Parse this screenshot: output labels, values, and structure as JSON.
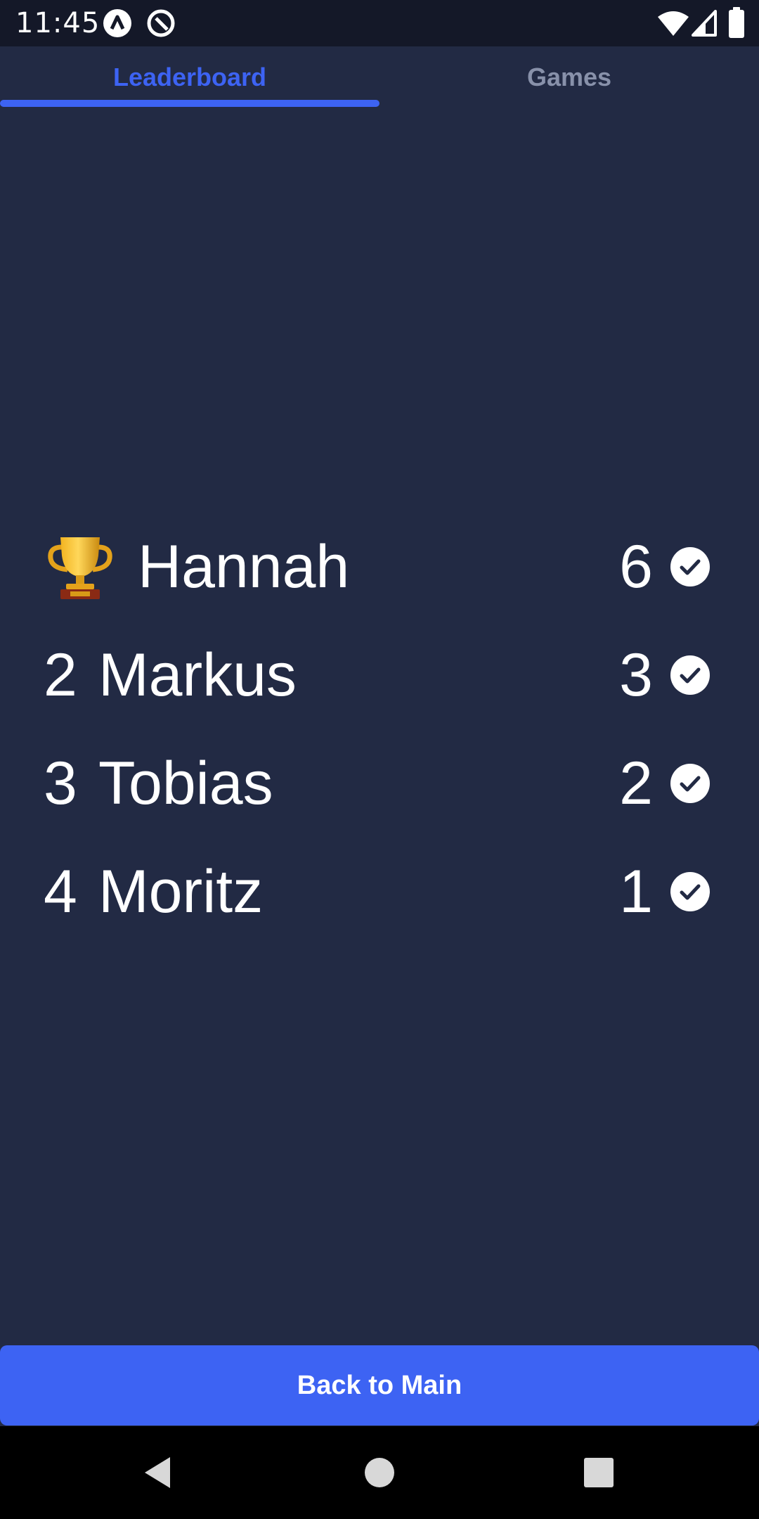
{
  "status_bar": {
    "time": "11:45",
    "icons": [
      "app-a-icon",
      "app-r-icon",
      "wifi-icon",
      "cellular-signal-icon",
      "battery-icon"
    ]
  },
  "tabs": [
    {
      "label": "Leaderboard",
      "active": true
    },
    {
      "label": "Games",
      "active": false
    }
  ],
  "leaderboard": {
    "rows": [
      {
        "rank": "",
        "rank_icon": "trophy-icon",
        "name": "Hannah",
        "score": "6"
      },
      {
        "rank": "2",
        "name": "Markus",
        "score": "3"
      },
      {
        "rank": "3",
        "name": "Tobias",
        "score": "2"
      },
      {
        "rank": "4",
        "name": "Moritz",
        "score": "1"
      }
    ]
  },
  "footer": {
    "back_button_label": "Back to Main"
  },
  "colors": {
    "background": "#222a44",
    "accent": "#3d63f3",
    "inactive_tab": "#8891aa",
    "status_bar": "#141828"
  }
}
